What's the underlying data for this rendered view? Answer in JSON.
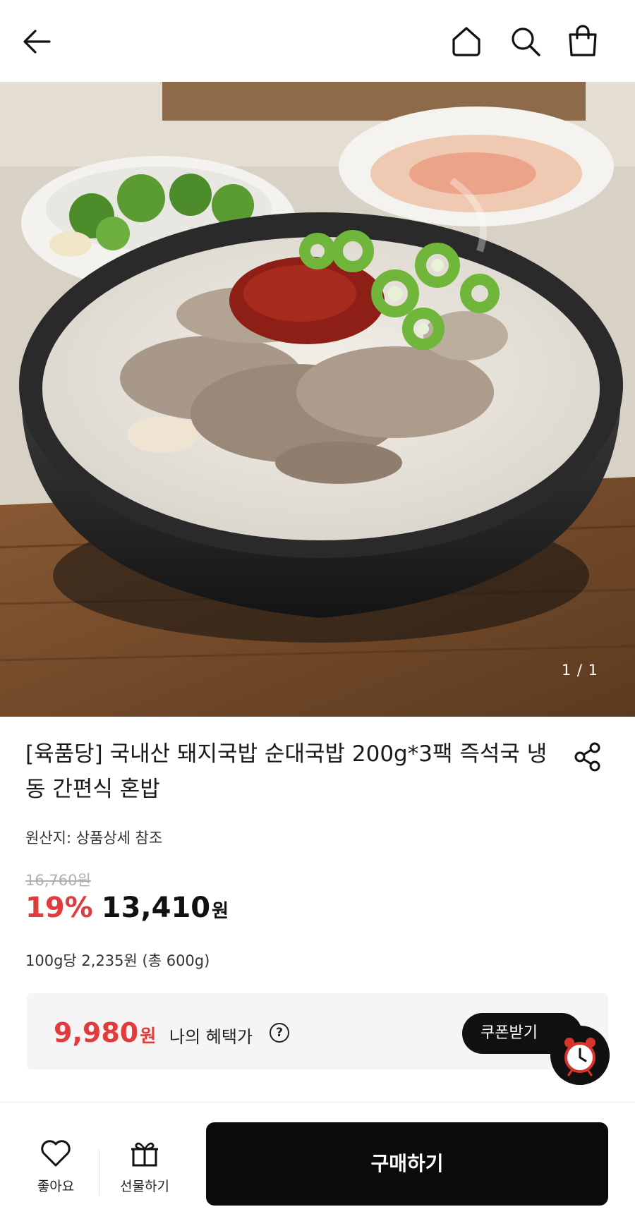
{
  "header": {
    "back_icon": "arrow-left-icon",
    "home_icon": "home-icon",
    "search_icon": "search-icon",
    "cart_icon": "shopping-bag-icon"
  },
  "gallery": {
    "counter": "1 / 1"
  },
  "product": {
    "title": "[육품당] 국내산 돼지국밥 순대국밥 200g*3팩 즉석국 냉동 간편식 혼밥",
    "origin": "원산지: 상품상세 참조",
    "original_price": "16,760원",
    "discount": "19%",
    "price": "13,410",
    "price_unit": "원",
    "unit_price": "100g당 2,235원 (총 600g)"
  },
  "benefit": {
    "price": "9,980",
    "price_unit": "원",
    "label": "나의 혜택가",
    "help": "?",
    "coupon_button": "쿠폰받기"
  },
  "bottom_bar": {
    "like_label": "좋아요",
    "gift_label": "선물하기",
    "buy_label": "구매하기"
  },
  "colors": {
    "accent_red": "#e23b3b",
    "dark_button": "#0b0b0b",
    "benefit_bg": "#f5f5f5"
  }
}
